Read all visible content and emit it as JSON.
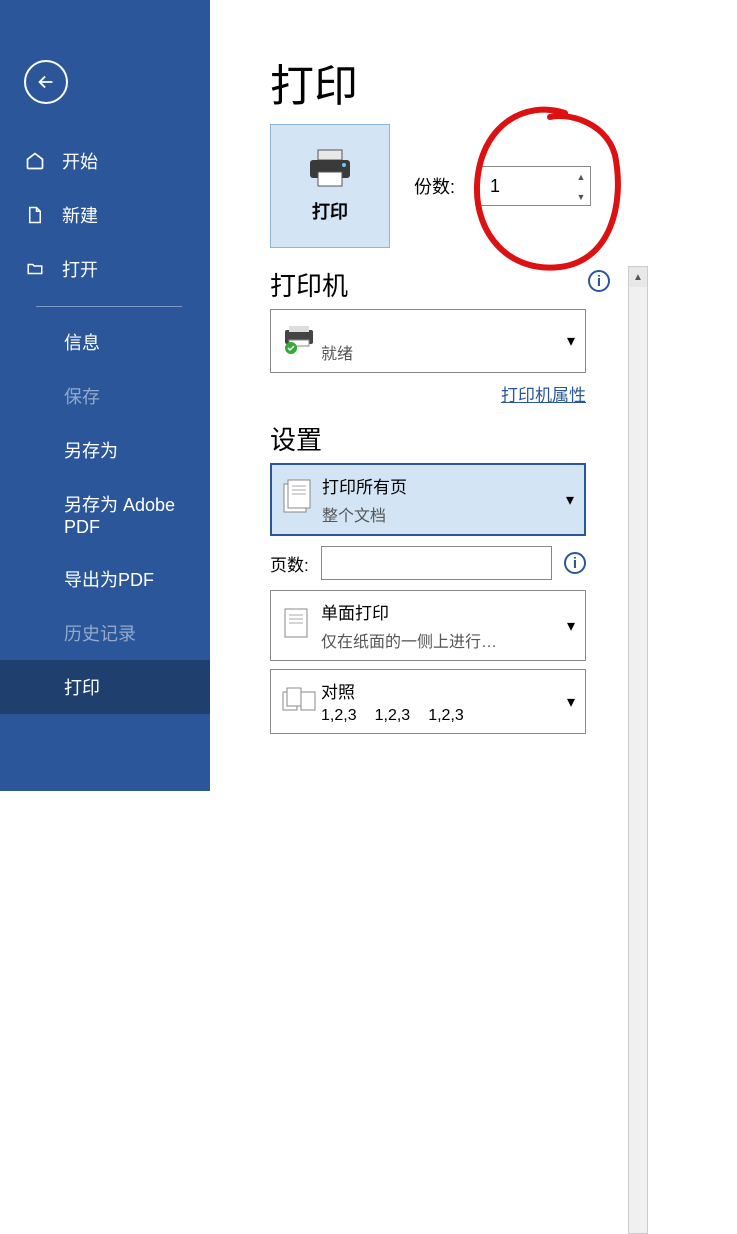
{
  "sidebar": {
    "home": "开始",
    "new": "新建",
    "open": "打开",
    "info": "信息",
    "save": "保存",
    "save_as": "另存为",
    "save_as_pdf": "另存为 Adobe PDF",
    "export_pdf": "导出为PDF",
    "history": "历史记录",
    "print": "打印"
  },
  "main": {
    "title": "打印",
    "print_button": "打印",
    "copies_label": "份数:",
    "copies_value": "1",
    "printer_section": "打印机",
    "printer_status": "就绪",
    "printer_properties": "打印机属性",
    "settings_section": "设置",
    "print_range": {
      "title": "打印所有页",
      "sub": "整个文档"
    },
    "pages_label": "页数:",
    "one_sided": {
      "title": "单面打印",
      "sub": "仅在纸面的一侧上进行…"
    },
    "collated": {
      "title": "对照",
      "seq1": "1,2,3",
      "seq2": "1,2,3",
      "seq3": "1,2,3"
    }
  }
}
